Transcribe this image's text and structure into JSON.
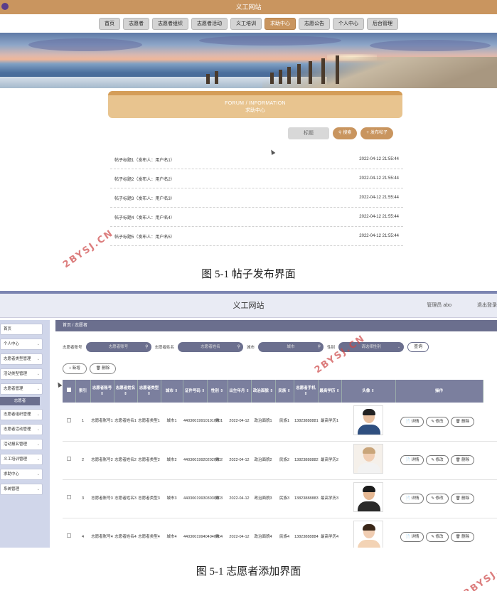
{
  "top": {
    "site_title": "义工网站",
    "nav": [
      "首页",
      "志愿者",
      "志愿者组织",
      "志愿者活动",
      "义工培训",
      "求助中心",
      "志愿公告",
      "个人中心",
      "后台管理"
    ],
    "nav_active_index": 5,
    "forum_en": "FORUM / INFORMATION",
    "forum_cn": "求助中心",
    "search_placeholder": "标题",
    "search_button": "搜索",
    "post_button": "发布帖子",
    "posts": [
      {
        "title": "帖子标题1（发布人：用户名1）",
        "time": "2022-04-12 21:55:44"
      },
      {
        "title": "帖子标题2（发布人：用户名2）",
        "time": "2022-04-12 21:55:44"
      },
      {
        "title": "帖子标题3（发布人：用户名3）",
        "time": "2022-04-12 21:55:44"
      },
      {
        "title": "帖子标题4（发布人：用户名4）",
        "time": "2022-04-12 21:55:44"
      },
      {
        "title": "帖子标题5（发布人：用户名5）",
        "time": "2022-04-12 21:55:44"
      }
    ]
  },
  "captions": {
    "top": "图 5-1  帖子发布界面",
    "bottom": "图 5-1  志愿者添加界面"
  },
  "watermark": "2BYSJ.CN",
  "bottom": {
    "site_title": "义工网站",
    "user_label": "管理员 abo",
    "logout_label": "退出登录",
    "sidebar": [
      {
        "label": "首页",
        "chev": false
      },
      {
        "label": "个人中心",
        "chev": true
      },
      {
        "label": "志愿者类型管理",
        "chev": true
      },
      {
        "label": "活动类型管理",
        "chev": true
      },
      {
        "label": "志愿者管理",
        "chev": true
      },
      {
        "label": "志愿者组织管理",
        "chev": true
      },
      {
        "label": "志愿者活动管理",
        "chev": true
      },
      {
        "label": "活动报名管理",
        "chev": true
      },
      {
        "label": "义工培训管理",
        "chev": true
      },
      {
        "label": "求助中心",
        "chev": true
      },
      {
        "label": "系统管理",
        "chev": true
      }
    ],
    "sidebar_sub": "志愿者",
    "breadcrumb": "首页  /  志愿者",
    "filters": {
      "account_label": "志愿者账号",
      "account_placeholder": "志愿者账号",
      "name_label": "志愿者姓名",
      "name_placeholder": "志愿者姓名",
      "city_label": "城市",
      "city_placeholder": "城市",
      "gender_label": "性别",
      "gender_placeholder": "请选择性别",
      "search_button": "查询"
    },
    "add_button": "+ 新增",
    "delete_button": "删除",
    "columns": [
      "索引",
      "志愿者账号 ⇕",
      "志愿者姓名 ⇕",
      "志愿者类型 ⇕",
      "城市 ⇕",
      "证件号码 ⇕",
      "性别 ⇕",
      "出生年月 ⇕",
      "政治面貌 ⇕",
      "民族 ⇕",
      "志愿者手机 ⇕",
      "最高学历 ⇕",
      "头像 ⇕",
      "操作"
    ],
    "rows": [
      {
        "index": "1",
        "account": "志愿者账号1",
        "name": "志愿者姓名1",
        "type": "志愿者类型1",
        "city": "城市1",
        "id": "440300199101010001",
        "gender": "男",
        "birth": "2022-04-12",
        "political": "政治面貌1",
        "ethnic": "民族1",
        "phone": "13823888881",
        "edu": "最高学历1"
      },
      {
        "index": "2",
        "account": "志愿者账号2",
        "name": "志愿者姓名2",
        "type": "志愿者类型2",
        "city": "城市2",
        "id": "440300199202020002",
        "gender": "男",
        "birth": "2022-04-12",
        "political": "政治面貌2",
        "ethnic": "民族2",
        "phone": "13823888882",
        "edu": "最高学历2"
      },
      {
        "index": "3",
        "account": "志愿者账号3",
        "name": "志愿者姓名3",
        "type": "志愿者类型3",
        "city": "城市3",
        "id": "440300199303030003",
        "gender": "男",
        "birth": "2022-04-12",
        "political": "政治面貌3",
        "ethnic": "民族3",
        "phone": "13823888883",
        "edu": "最高学历3"
      },
      {
        "index": "4",
        "account": "志愿者账号4",
        "name": "志愿者姓名4",
        "type": "志愿者类型4",
        "city": "城市4",
        "id": "440300199404040004",
        "gender": "男",
        "birth": "2022-04-12",
        "political": "政治面貌4",
        "ethnic": "民族4",
        "phone": "13823888884",
        "edu": "最高学历4"
      }
    ],
    "row_actions": [
      "详情",
      "修改",
      "删除"
    ]
  }
}
